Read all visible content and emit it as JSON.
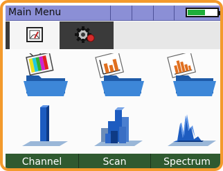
{
  "title_bar": {
    "title": "Main Menu",
    "battery_level": 0.6
  },
  "tabs": [
    {
      "name": "analysis-tab",
      "icon": "meter-icon",
      "active": true
    },
    {
      "name": "settings-tab",
      "icon": "gear-icon",
      "active": false
    }
  ],
  "menu": {
    "icons": [
      {
        "name": "channel-folder-icon",
        "icon": "tv-folder"
      },
      {
        "name": "scan-folder-icon",
        "icon": "chart-folder"
      },
      {
        "name": "spectrum-folder-icon",
        "icon": "chart-folder"
      },
      {
        "name": "channel-mode-icon",
        "icon": "single-bar-chart"
      },
      {
        "name": "scan-mode-icon",
        "icon": "3d-bar-chart"
      },
      {
        "name": "spectrum-mode-icon",
        "icon": "spectrum-chart"
      }
    ]
  },
  "softkeys": {
    "channel": "Channel",
    "scan": "Scan",
    "spectrum": "Spectrum"
  },
  "colors": {
    "frame": "#f39a2c",
    "titlebar": "#8b8fd6",
    "softkeys": "#2f5a30",
    "battery": "#1fae3a"
  }
}
